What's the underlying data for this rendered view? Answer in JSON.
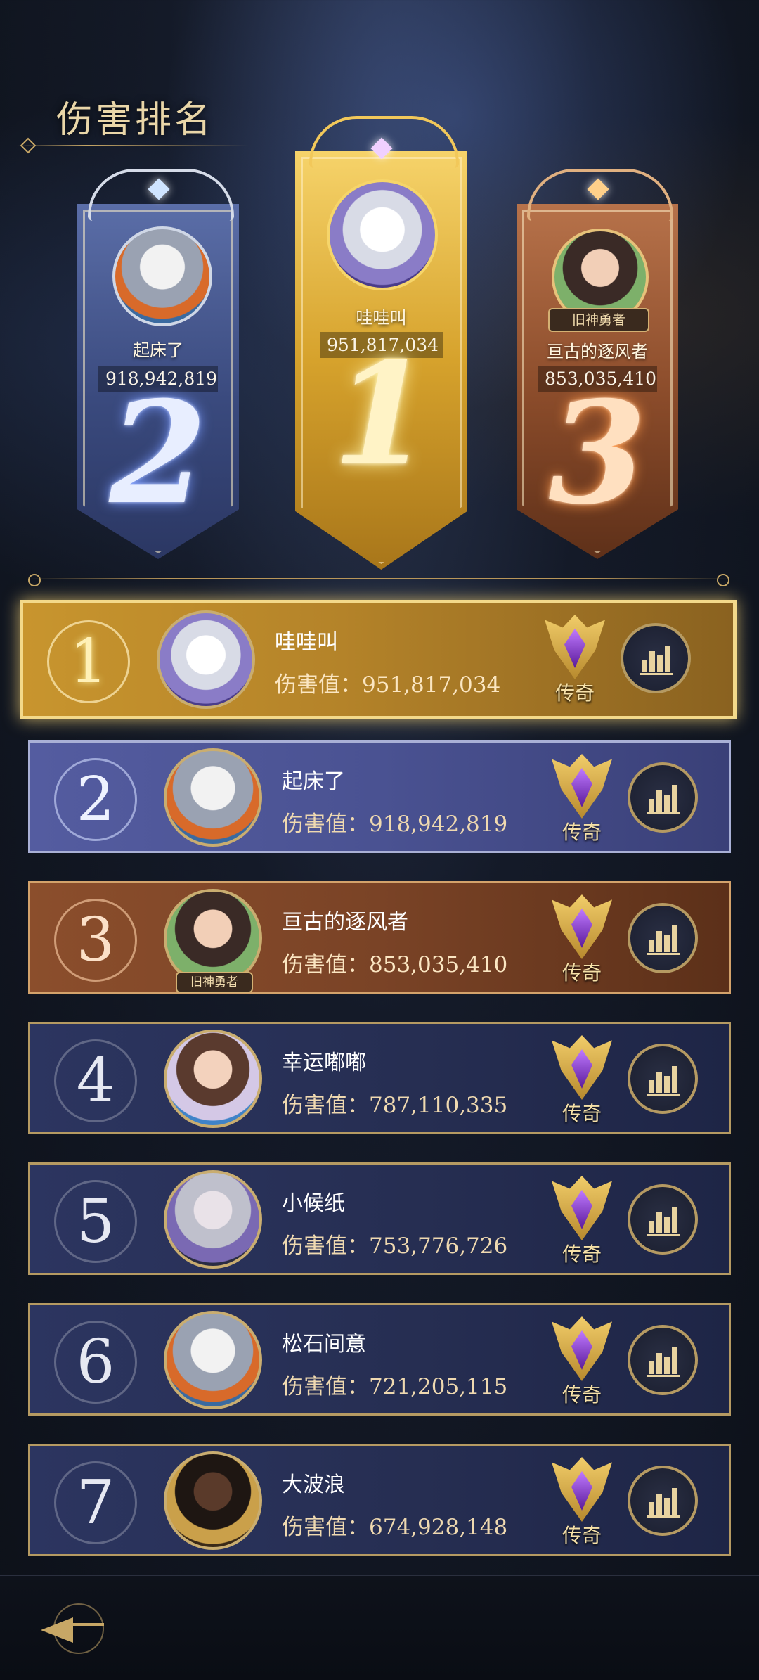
{
  "title": "伤害排名",
  "podium": [
    {
      "rank": "2",
      "name": "起床了",
      "score": "918,942,819"
    },
    {
      "rank": "1",
      "name": "哇哇叫",
      "score": "951,817,034"
    },
    {
      "rank": "3",
      "name": "亘古的逐风者",
      "score": "853,035,410",
      "badge": "旧神勇者"
    }
  ],
  "score_label": "伤害值：",
  "tier_label": "传奇",
  "rows": [
    {
      "rank": "1",
      "name": "哇哇叫",
      "score": "951,817,034"
    },
    {
      "rank": "2",
      "name": "起床了",
      "score": "918,942,819"
    },
    {
      "rank": "3",
      "name": "亘古的逐风者",
      "score": "853,035,410",
      "badge": "旧神勇者"
    },
    {
      "rank": "4",
      "name": "幸运嘟嘟",
      "score": "787,110,335"
    },
    {
      "rank": "5",
      "name": "小候纸",
      "score": "753,776,726"
    },
    {
      "rank": "6",
      "name": "松石间意",
      "score": "721,205,115"
    },
    {
      "rank": "7",
      "name": "大波浪",
      "score": "674,928,148"
    }
  ],
  "icons": {
    "tier": "legendary-badge-icon",
    "stats": "bar-chart-icon",
    "back": "back-arrow-icon"
  },
  "colors": {
    "gold": "#f3d98a",
    "silver": "#a9b0d6",
    "bronze": "#d3a26b",
    "text_score": "#efd9b0"
  }
}
